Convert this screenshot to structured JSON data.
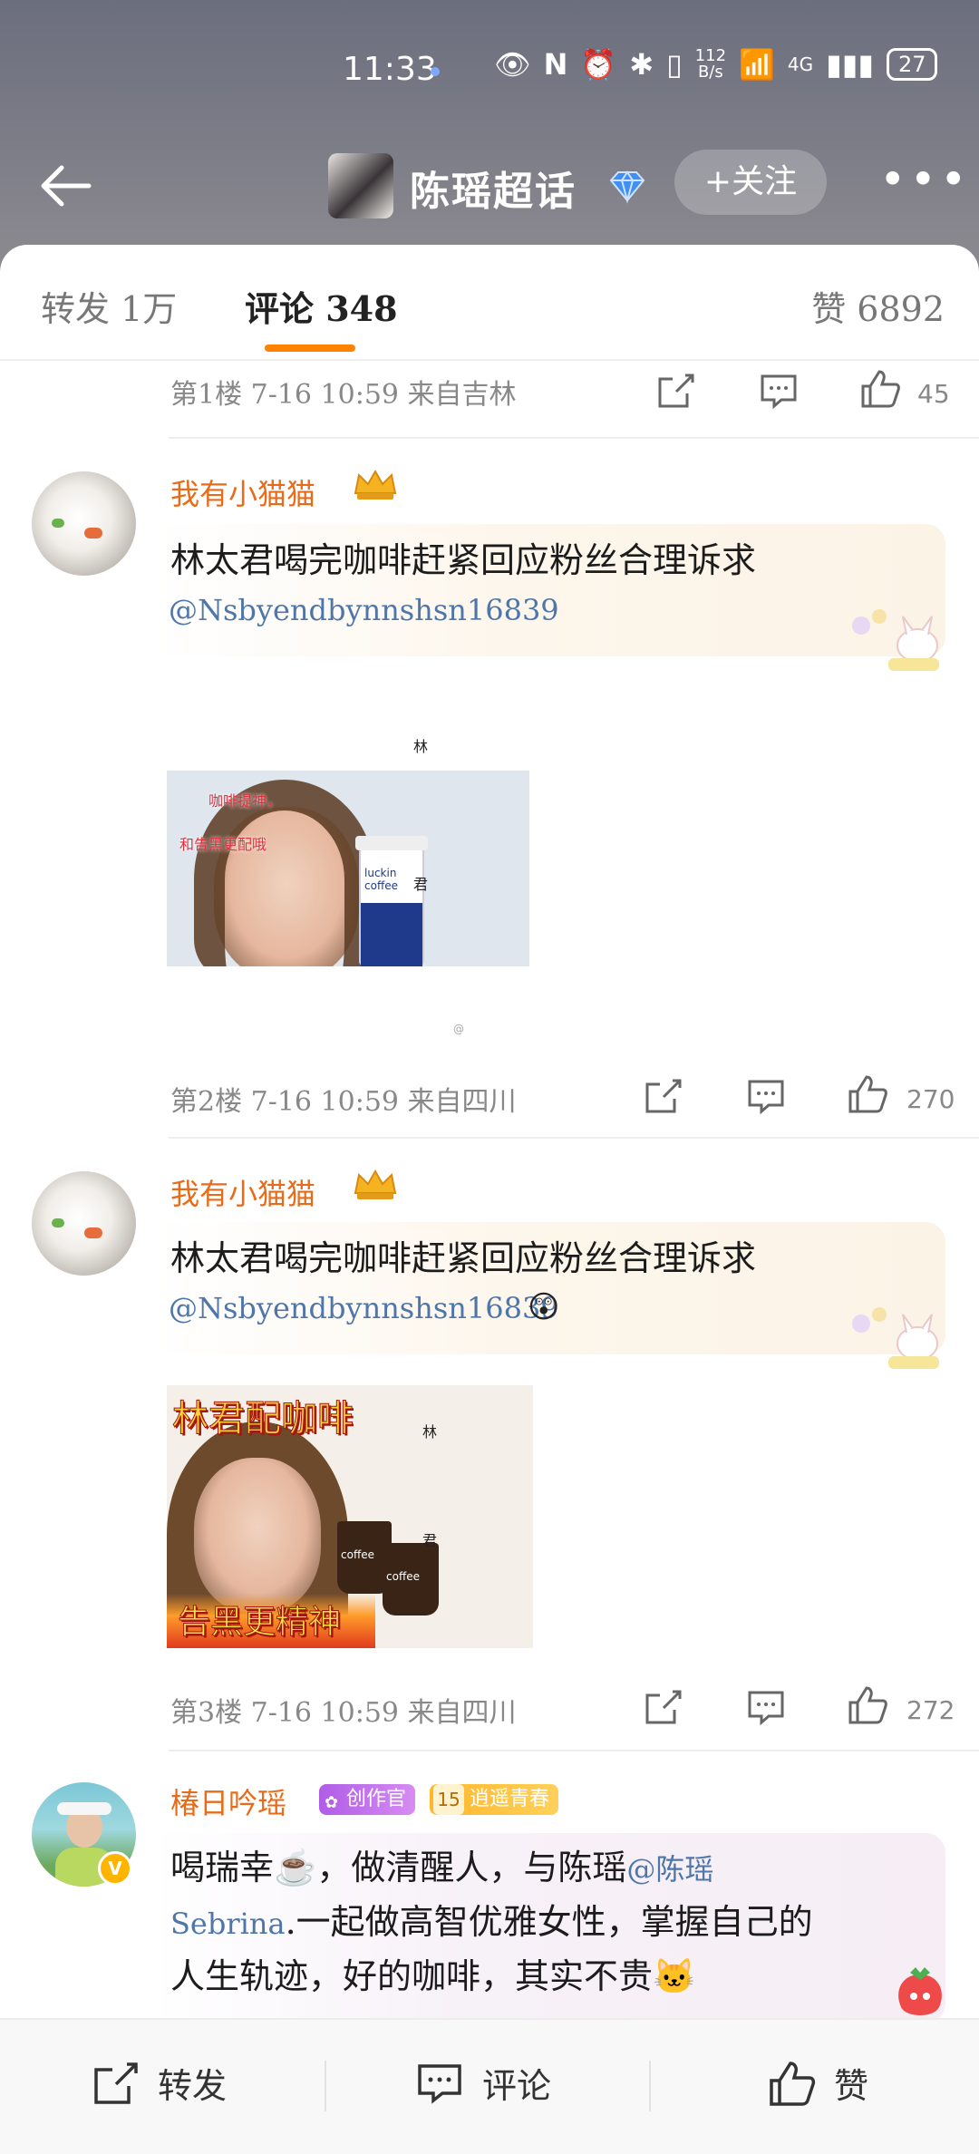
{
  "status": {
    "time": "11:33",
    "net_speed_top": "112",
    "net_speed_bottom": "B/s",
    "signal_label": "4G",
    "battery": "27"
  },
  "nav": {
    "title": "陈瑶超话",
    "follow_label": "+关注"
  },
  "tabs": {
    "repost": "转发 1万",
    "comment": "评论 348",
    "like": "赞 6892"
  },
  "comments": [
    {
      "floor_meta": "第1楼 7-16 10:59 来自吉林",
      "likes": "45"
    },
    {
      "user": "我有小猫猫",
      "text": "林太君喝完咖啡赶紧回应粉丝合理诉求",
      "mention": "@Nsbyendbynnshsn16839",
      "meme_caption_1": "咖啡提神，",
      "meme_caption_2": "和告黑更配哦",
      "meme_char_1": "林",
      "meme_char_2": "君",
      "meme_cup": "luckin coffee",
      "floor_meta": "第2楼 7-16 10:59 来自四川",
      "likes": "270"
    },
    {
      "user": "我有小猫猫",
      "text": "林太君喝完咖啡赶紧回应粉丝合理诉求",
      "mention": "@Nsbyendbynnshsn16839",
      "mention_emoji": "😲",
      "meme_caption_1": "林君配咖啡",
      "meme_caption_2": "告黑更精神",
      "meme_char_1": "林",
      "meme_char_2": "君",
      "meme_cup": "coffee",
      "floor_meta": "第3楼 7-16 10:59 来自四川",
      "likes": "272"
    },
    {
      "user": "椿日吟瑶",
      "badge_1": "创作官",
      "badge_2": "逍遥青春",
      "badge_2_level": "15",
      "text_line_1": "喝瑞幸☕️，做清醒人，与陈瑶",
      "text_mention": "@陈瑶",
      "text_line_2_mention": "Sebrina",
      "text_line_2": ".一起做高智优雅女性，掌握自己的",
      "text_line_3": "人生轨迹，好的咖啡，其实不贵🐱"
    }
  ],
  "bottom": {
    "repost": "转发",
    "comment": "评论",
    "like": "赞"
  },
  "colors": {
    "accent": "#ff8200",
    "username": "#e86b1a",
    "mention": "#4f76a8",
    "meme_red": "#ef2b3c"
  }
}
